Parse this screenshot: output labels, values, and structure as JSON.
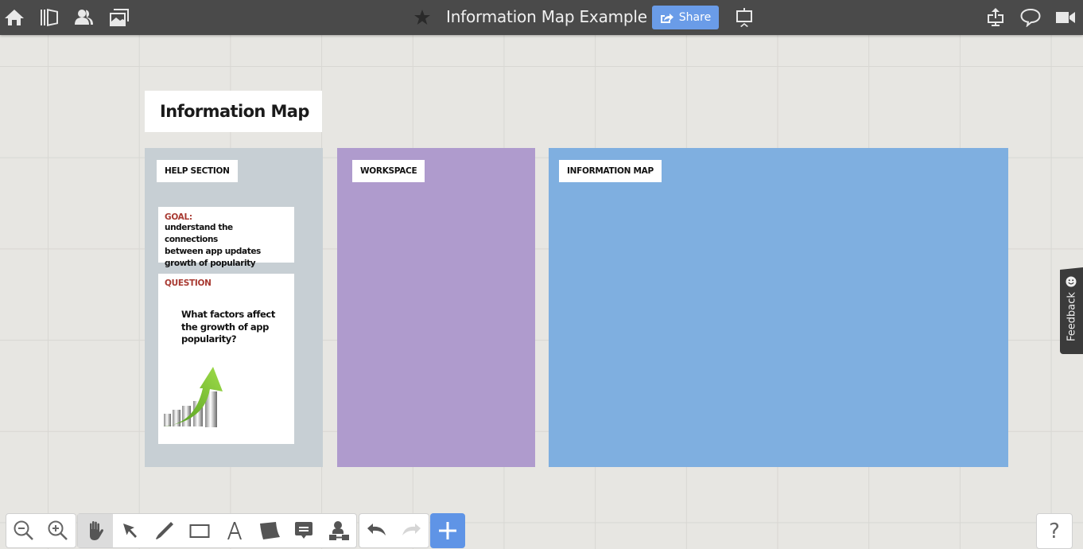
{
  "topbar": {
    "left_icons": [
      "home-icon",
      "library-icon",
      "users-icon",
      "gallery-icon"
    ],
    "title": "Information Map Example",
    "share_label": "Share",
    "right_icons": [
      "export-icon",
      "comment-icon",
      "video-icon"
    ]
  },
  "board": {
    "title": "Information Map",
    "frames": [
      {
        "label": "HELP SECTION",
        "color": "#c7cfd4"
      },
      {
        "label": "WORKSPACE",
        "color": "#af9bcd"
      },
      {
        "label": "INFORMATION MAP",
        "color": "#7fafe0"
      }
    ],
    "goal_note": {
      "heading": "GOAL:",
      "lines": [
        "understand the connections",
        "between app updates",
        "growth of popularity"
      ]
    },
    "question_note": {
      "heading": "QUESTION",
      "lines": [
        "What factors affect",
        "the growth of app",
        "popularity?"
      ]
    }
  },
  "feedback": {
    "label": "Feedback"
  },
  "toolbar": {
    "tools": [
      "zoom-out",
      "zoom-in",
      "hand",
      "select",
      "pen",
      "rectangle",
      "text",
      "sticky-note",
      "comment",
      "org-chart"
    ],
    "active_tool": "hand",
    "history": [
      "undo",
      "redo"
    ],
    "add_label": "+",
    "help_label": "?"
  },
  "colors": {
    "accent": "#6a9ce8",
    "add_button": "#5f94e6",
    "note_heading": "#a83a32"
  }
}
